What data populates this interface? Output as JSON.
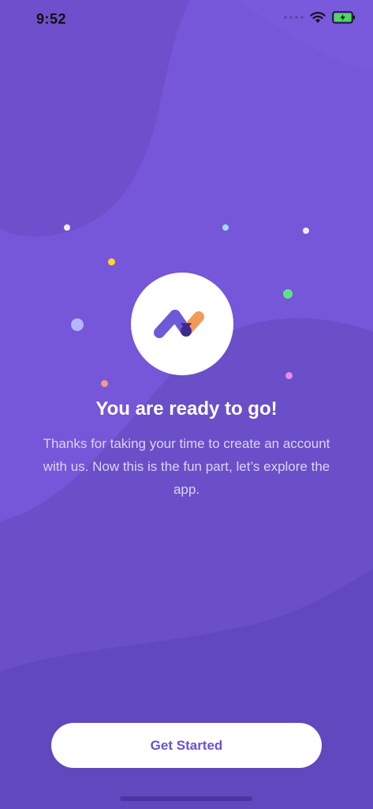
{
  "status_bar": {
    "time": "9:52"
  },
  "onboarding": {
    "title": "You are ready to go!",
    "description": "Thanks for taking your time to create an account with us. Now this is the fun part, let’s explore the app.",
    "cta_label": "Get Started"
  },
  "colors": {
    "background": "#7656d9",
    "accent": "#6a51d6",
    "logo_orange": "#f29a5a",
    "logo_purple": "#6e5ad8",
    "logo_dark": "#3d2a8e"
  },
  "icons": [
    "wifi-icon",
    "battery-charging-icon",
    "app-logo-icon"
  ]
}
